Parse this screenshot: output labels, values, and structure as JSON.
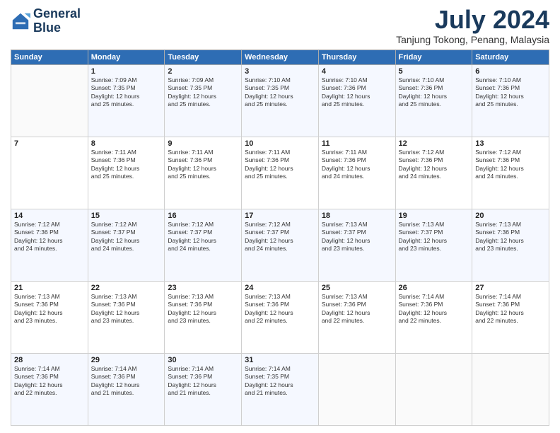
{
  "logo": {
    "line1": "General",
    "line2": "Blue"
  },
  "title": "July 2024",
  "location": "Tanjung Tokong, Penang, Malaysia",
  "header": {
    "days": [
      "Sunday",
      "Monday",
      "Tuesday",
      "Wednesday",
      "Thursday",
      "Friday",
      "Saturday"
    ]
  },
  "weeks": [
    [
      {
        "day": "",
        "content": ""
      },
      {
        "day": "1",
        "content": "Sunrise: 7:09 AM\nSunset: 7:35 PM\nDaylight: 12 hours\nand 25 minutes."
      },
      {
        "day": "2",
        "content": "Sunrise: 7:09 AM\nSunset: 7:35 PM\nDaylight: 12 hours\nand 25 minutes."
      },
      {
        "day": "3",
        "content": "Sunrise: 7:10 AM\nSunset: 7:35 PM\nDaylight: 12 hours\nand 25 minutes."
      },
      {
        "day": "4",
        "content": "Sunrise: 7:10 AM\nSunset: 7:36 PM\nDaylight: 12 hours\nand 25 minutes."
      },
      {
        "day": "5",
        "content": "Sunrise: 7:10 AM\nSunset: 7:36 PM\nDaylight: 12 hours\nand 25 minutes."
      },
      {
        "day": "6",
        "content": "Sunrise: 7:10 AM\nSunset: 7:36 PM\nDaylight: 12 hours\nand 25 minutes."
      }
    ],
    [
      {
        "day": "7",
        "content": ""
      },
      {
        "day": "8",
        "content": "Sunrise: 7:11 AM\nSunset: 7:36 PM\nDaylight: 12 hours\nand 25 minutes."
      },
      {
        "day": "9",
        "content": "Sunrise: 7:11 AM\nSunset: 7:36 PM\nDaylight: 12 hours\nand 25 minutes."
      },
      {
        "day": "10",
        "content": "Sunrise: 7:11 AM\nSunset: 7:36 PM\nDaylight: 12 hours\nand 25 minutes."
      },
      {
        "day": "11",
        "content": "Sunrise: 7:11 AM\nSunset: 7:36 PM\nDaylight: 12 hours\nand 24 minutes."
      },
      {
        "day": "12",
        "content": "Sunrise: 7:12 AM\nSunset: 7:36 PM\nDaylight: 12 hours\nand 24 minutes."
      },
      {
        "day": "13",
        "content": "Sunrise: 7:12 AM\nSunset: 7:36 PM\nDaylight: 12 hours\nand 24 minutes."
      }
    ],
    [
      {
        "day": "14",
        "content": "Sunrise: 7:12 AM\nSunset: 7:36 PM\nDaylight: 12 hours\nand 24 minutes."
      },
      {
        "day": "15",
        "content": "Sunrise: 7:12 AM\nSunset: 7:37 PM\nDaylight: 12 hours\nand 24 minutes."
      },
      {
        "day": "16",
        "content": "Sunrise: 7:12 AM\nSunset: 7:37 PM\nDaylight: 12 hours\nand 24 minutes."
      },
      {
        "day": "17",
        "content": "Sunrise: 7:12 AM\nSunset: 7:37 PM\nDaylight: 12 hours\nand 24 minutes."
      },
      {
        "day": "18",
        "content": "Sunrise: 7:13 AM\nSunset: 7:37 PM\nDaylight: 12 hours\nand 23 minutes."
      },
      {
        "day": "19",
        "content": "Sunrise: 7:13 AM\nSunset: 7:37 PM\nDaylight: 12 hours\nand 23 minutes."
      },
      {
        "day": "20",
        "content": "Sunrise: 7:13 AM\nSunset: 7:36 PM\nDaylight: 12 hours\nand 23 minutes."
      }
    ],
    [
      {
        "day": "21",
        "content": "Sunrise: 7:13 AM\nSunset: 7:36 PM\nDaylight: 12 hours\nand 23 minutes."
      },
      {
        "day": "22",
        "content": "Sunrise: 7:13 AM\nSunset: 7:36 PM\nDaylight: 12 hours\nand 23 minutes."
      },
      {
        "day": "23",
        "content": "Sunrise: 7:13 AM\nSunset: 7:36 PM\nDaylight: 12 hours\nand 23 minutes."
      },
      {
        "day": "24",
        "content": "Sunrise: 7:13 AM\nSunset: 7:36 PM\nDaylight: 12 hours\nand 22 minutes."
      },
      {
        "day": "25",
        "content": "Sunrise: 7:13 AM\nSunset: 7:36 PM\nDaylight: 12 hours\nand 22 minutes."
      },
      {
        "day": "26",
        "content": "Sunrise: 7:14 AM\nSunset: 7:36 PM\nDaylight: 12 hours\nand 22 minutes."
      },
      {
        "day": "27",
        "content": "Sunrise: 7:14 AM\nSunset: 7:36 PM\nDaylight: 12 hours\nand 22 minutes."
      }
    ],
    [
      {
        "day": "28",
        "content": "Sunrise: 7:14 AM\nSunset: 7:36 PM\nDaylight: 12 hours\nand 22 minutes."
      },
      {
        "day": "29",
        "content": "Sunrise: 7:14 AM\nSunset: 7:36 PM\nDaylight: 12 hours\nand 21 minutes."
      },
      {
        "day": "30",
        "content": "Sunrise: 7:14 AM\nSunset: 7:36 PM\nDaylight: 12 hours\nand 21 minutes."
      },
      {
        "day": "31",
        "content": "Sunrise: 7:14 AM\nSunset: 7:35 PM\nDaylight: 12 hours\nand 21 minutes."
      },
      {
        "day": "",
        "content": ""
      },
      {
        "day": "",
        "content": ""
      },
      {
        "day": "",
        "content": ""
      }
    ]
  ]
}
